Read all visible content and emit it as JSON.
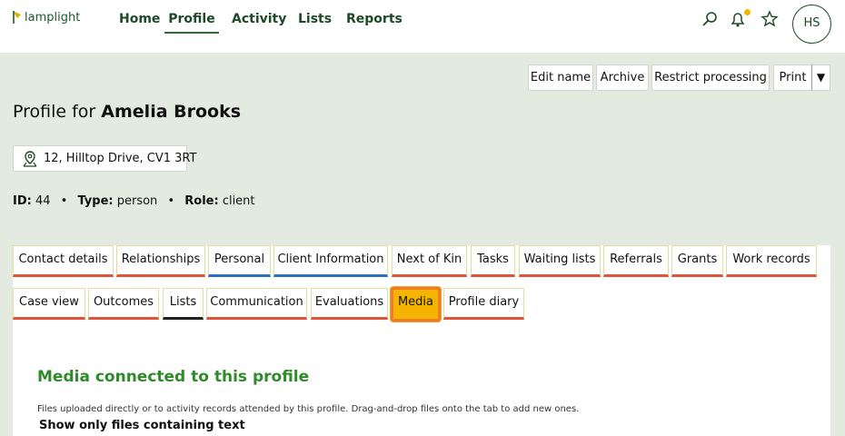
{
  "header": {
    "logo_text": "lamplight",
    "nav": [
      "Home",
      "Profile",
      "Activity",
      "Lists",
      "Reports"
    ],
    "active_nav": "Profile",
    "avatar_initials": "HS"
  },
  "actions": {
    "edit_name": "Edit name",
    "archive": "Archive",
    "restrict": "Restrict processing",
    "print": "Print",
    "print_menu": "▼"
  },
  "profile": {
    "title_prefix": "Profile for",
    "name": "Amelia Brooks",
    "address": "12, Hilltop Drive, CV1 3RT",
    "id_label": "ID:",
    "id": "44",
    "type_label": "Type:",
    "type": "person",
    "role_label": "Role:",
    "role": "client"
  },
  "tabs_row1": [
    "Contact details",
    "Relationships",
    "Personal",
    "Client Information",
    "Next of Kin",
    "Tasks",
    "Waiting lists",
    "Referrals",
    "Grants",
    "Work records"
  ],
  "tabs_row2": [
    "Case view",
    "Outcomes",
    "Lists",
    "Communication",
    "Evaluations",
    "Media",
    "Profile diary"
  ],
  "active_tab": "Media",
  "media": {
    "heading": "Media connected to this profile",
    "description": "Files uploaded directly or to activity records attended by this profile. Drag-and-drop files onto the tab to add new ones.",
    "filter_label": "Show only files containing text"
  },
  "colors": {
    "brand_green": "#1d4a25",
    "page_bg": "#e3ebe0",
    "active_tab": "#f5b400",
    "heading_green": "#2f8a2a",
    "notification_dot": "#f4b400"
  }
}
